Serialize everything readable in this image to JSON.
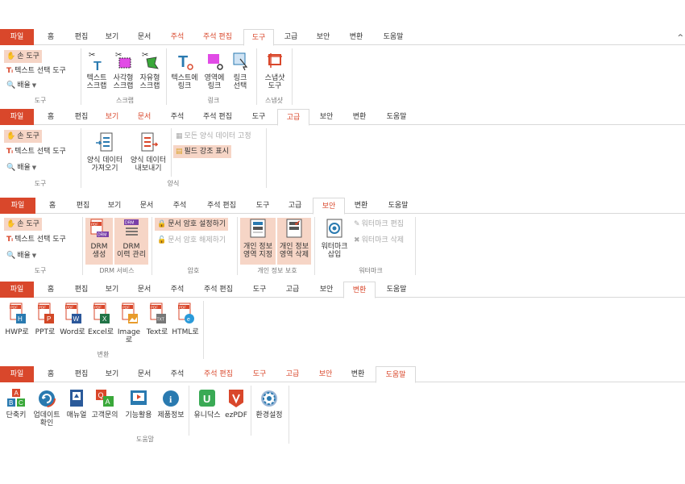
{
  "ribbon1": {
    "tabs": [
      "파일",
      "홈",
      "편집",
      "보기",
      "문서",
      "주석",
      "주석 편집",
      "도구",
      "고급",
      "보안",
      "변환",
      "도움말"
    ],
    "groups": {
      "tools": {
        "label": "도구",
        "hand": "손 도구",
        "text_select": "텍스트 선택 도구",
        "zoom": "배율"
      },
      "scrap": {
        "label": "스크랩",
        "items": [
          "텍스트\n스크랩",
          "사각형\n스크랩",
          "자유형\n스크랩"
        ]
      },
      "link": {
        "label": "링크",
        "items": [
          "텍스트에\n링크",
          "영역에\n링크",
          "링크\n선택"
        ]
      },
      "snapshot": {
        "label": "스냅샷",
        "items": [
          "스냅샷\n도구"
        ]
      }
    }
  },
  "ribbon2": {
    "tabs": [
      "파일",
      "홈",
      "편집",
      "보기",
      "문서",
      "주석",
      "주석 편집",
      "도구",
      "고급",
      "보안",
      "변환",
      "도움말"
    ],
    "groups": {
      "tools": {
        "label": "도구",
        "hand": "손 도구",
        "text_select": "텍스트 선택 도구",
        "zoom": "배율"
      },
      "form": {
        "label": "양식",
        "items": [
          "양식 데이터\n가져오기",
          "양식 데이터\n내보내기"
        ],
        "fix": "모든 양식 데이터 고정",
        "highlight": "필드 강조 표시"
      }
    }
  },
  "ribbon3": {
    "tabs": [
      "파일",
      "홈",
      "편집",
      "보기",
      "문서",
      "주석",
      "주석 편집",
      "도구",
      "고급",
      "보안",
      "변환",
      "도움말"
    ],
    "groups": {
      "tools": {
        "label": "도구",
        "hand": "손 도구",
        "text_select": "텍스트 선택 도구",
        "zoom": "배율"
      },
      "drm": {
        "label": "DRM 서비스",
        "items": [
          "DRM\n생성",
          "DRM\n이력 관리"
        ]
      },
      "password": {
        "label": "암호",
        "set": "문서 암호 설정하기",
        "remove": "문서 암호 해제하기"
      },
      "privacy": {
        "label": "개인 정보 보호",
        "items": [
          "개인 정보\n영역 지정",
          "개인 정보\n영역 삭제"
        ]
      },
      "watermark": {
        "label": "워터마크",
        "insert": "워터마크\n삽입",
        "edit": "워터마크 편집",
        "delete": "워터마크 삭제"
      }
    }
  },
  "ribbon4": {
    "tabs": [
      "파일",
      "홈",
      "편집",
      "보기",
      "문서",
      "주석",
      "주석 편집",
      "도구",
      "고급",
      "보안",
      "변환",
      "도움말"
    ],
    "groups": {
      "convert": {
        "label": "변환",
        "items": [
          "HWP로",
          "PPT로",
          "Word로",
          "Excel로",
          "Image로",
          "Text로",
          "HTML로"
        ]
      }
    }
  },
  "ribbon5": {
    "tabs": [
      "파일",
      "홈",
      "편집",
      "보기",
      "문서",
      "주석",
      "주석 편집",
      "도구",
      "고급",
      "보안",
      "변환",
      "도움말"
    ],
    "groups": {
      "help": {
        "label": "도움말",
        "items": [
          "단축키",
          "업데이트\n확인",
          "매뉴얼",
          "고객문의",
          "기능활용",
          "제품정보",
          "유니닥스",
          "ezPDF",
          "환경설정"
        ]
      }
    }
  },
  "misc": {
    "topright": "^"
  },
  "colors": {
    "accent": "#d9472b",
    "highlight": "#f6d5c6",
    "file_tab": "#d9472b"
  }
}
